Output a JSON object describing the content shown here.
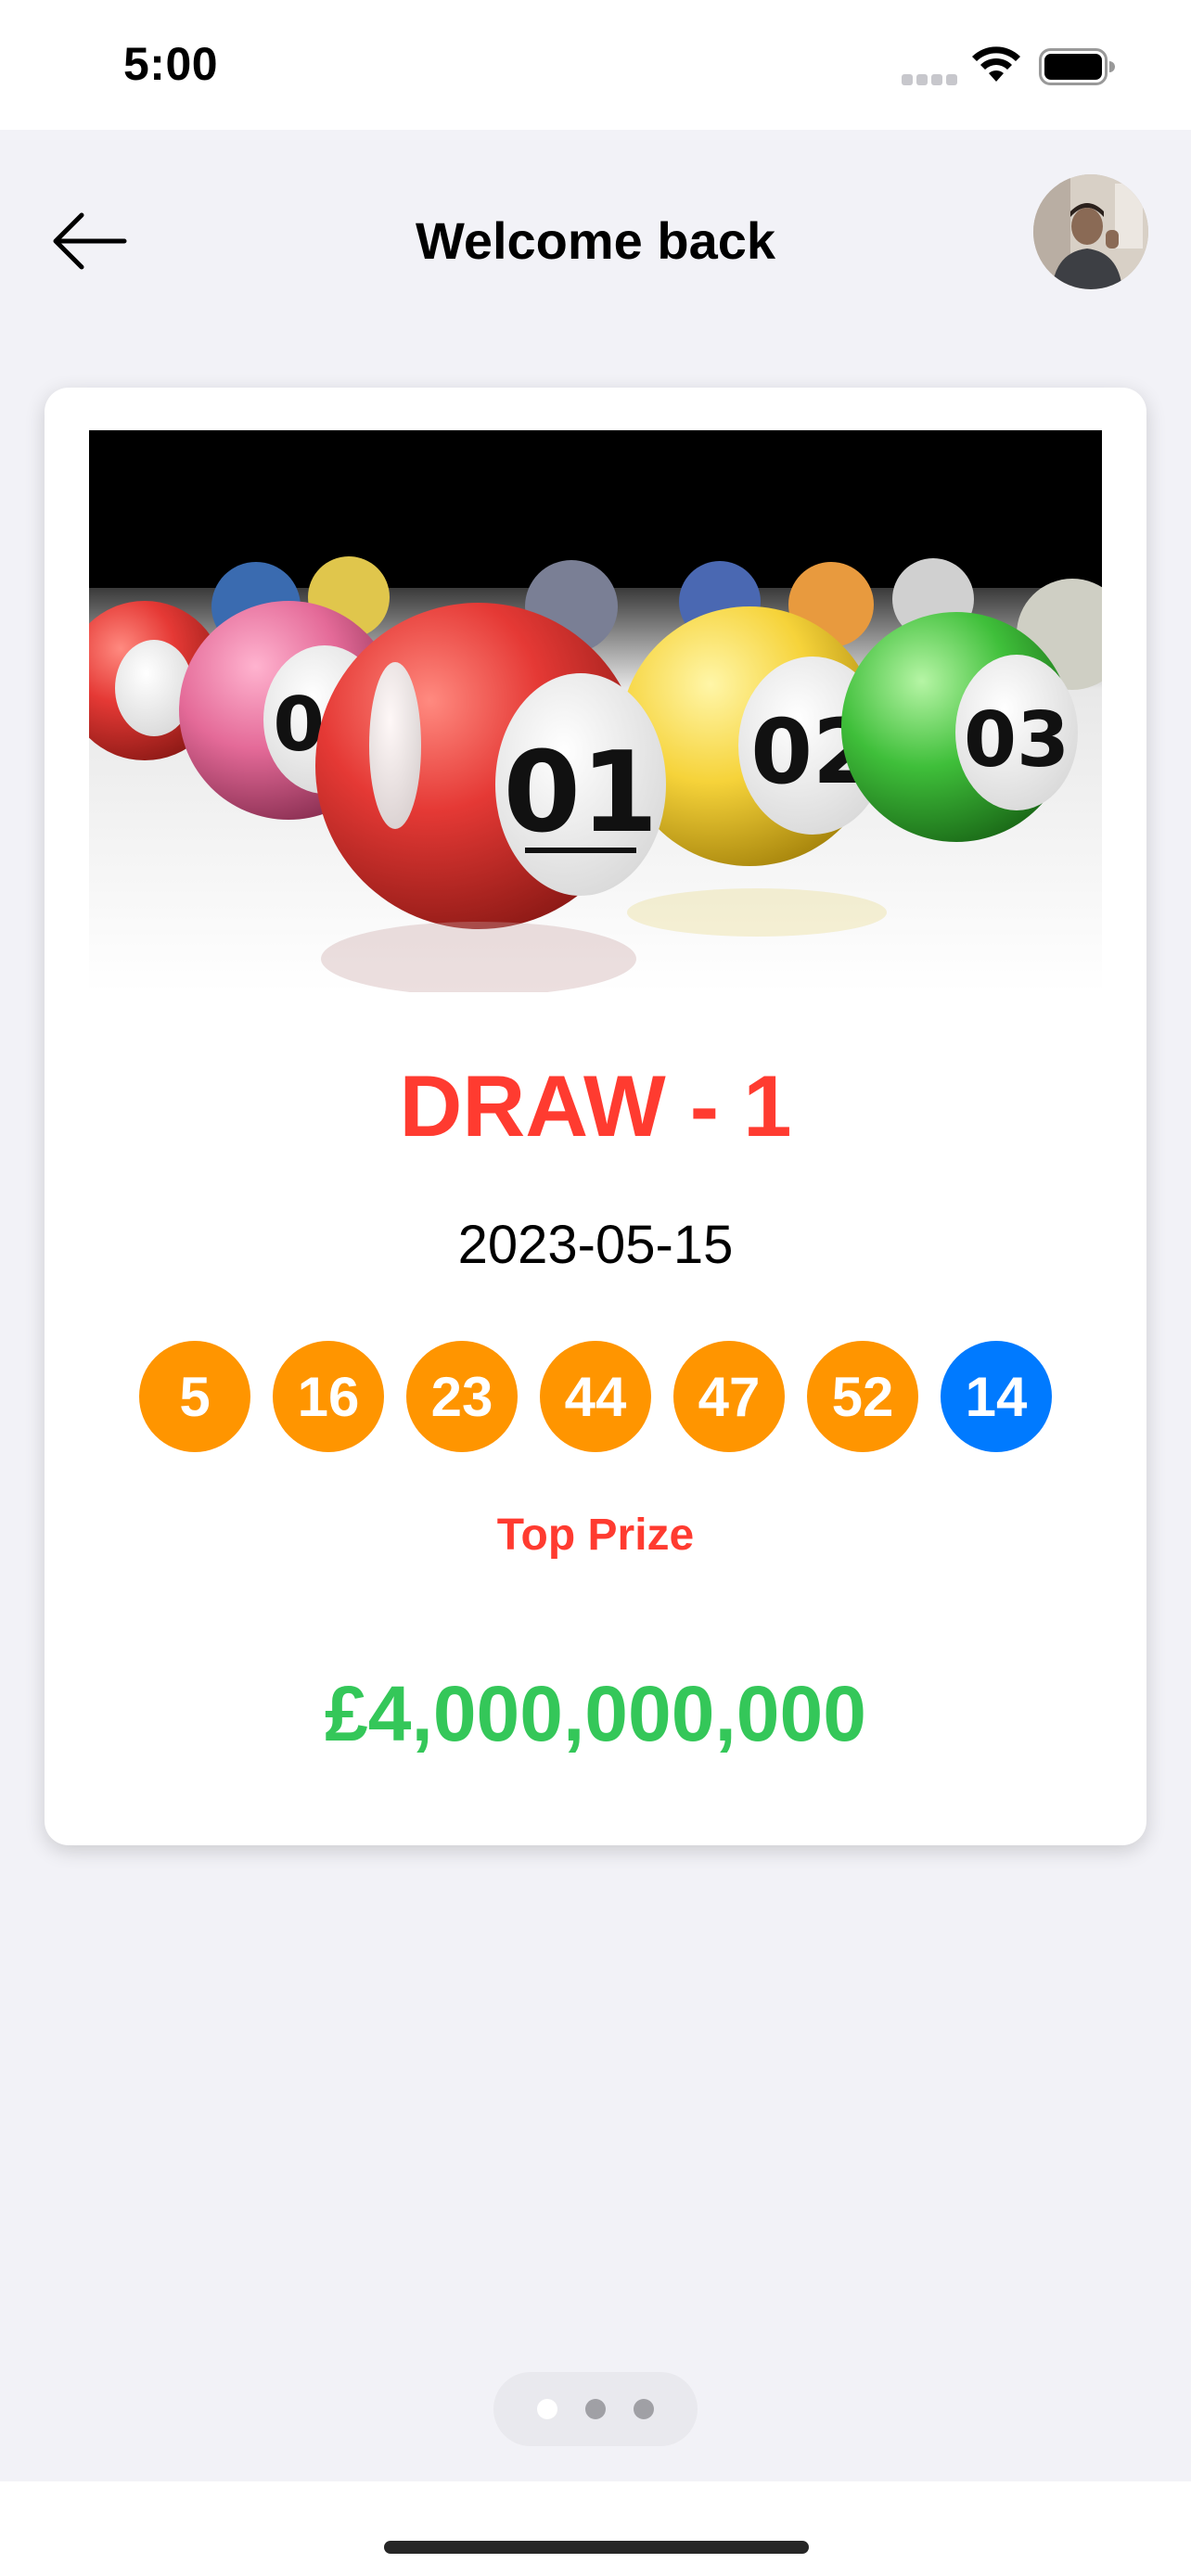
{
  "status_bar": {
    "time": "5:00"
  },
  "header": {
    "title": "Welcome back",
    "back_icon": "arrow-left-icon",
    "avatar_icon": "user-avatar"
  },
  "card": {
    "image_icon": "lottery-balls-image",
    "draw_title": "DRAW - 1",
    "date": "2023-05-15",
    "balls": [
      {
        "number": "5",
        "color": "#ff9500"
      },
      {
        "number": "16",
        "color": "#ff9500"
      },
      {
        "number": "23",
        "color": "#ff9500"
      },
      {
        "number": "44",
        "color": "#ff9500"
      },
      {
        "number": "47",
        "color": "#ff9500"
      },
      {
        "number": "52",
        "color": "#ff9500"
      },
      {
        "number": "14",
        "color": "#007aff"
      }
    ],
    "prize_label": "Top Prize",
    "prize_amount": "£4,000,000,000"
  },
  "pager": {
    "pages": 3,
    "active_index": 0
  },
  "colors": {
    "title_red": "#ff3b30",
    "prize_green": "#34c759",
    "main_ball": "#ff9500",
    "bonus_ball": "#007aff",
    "background": "#f2f2f7"
  }
}
